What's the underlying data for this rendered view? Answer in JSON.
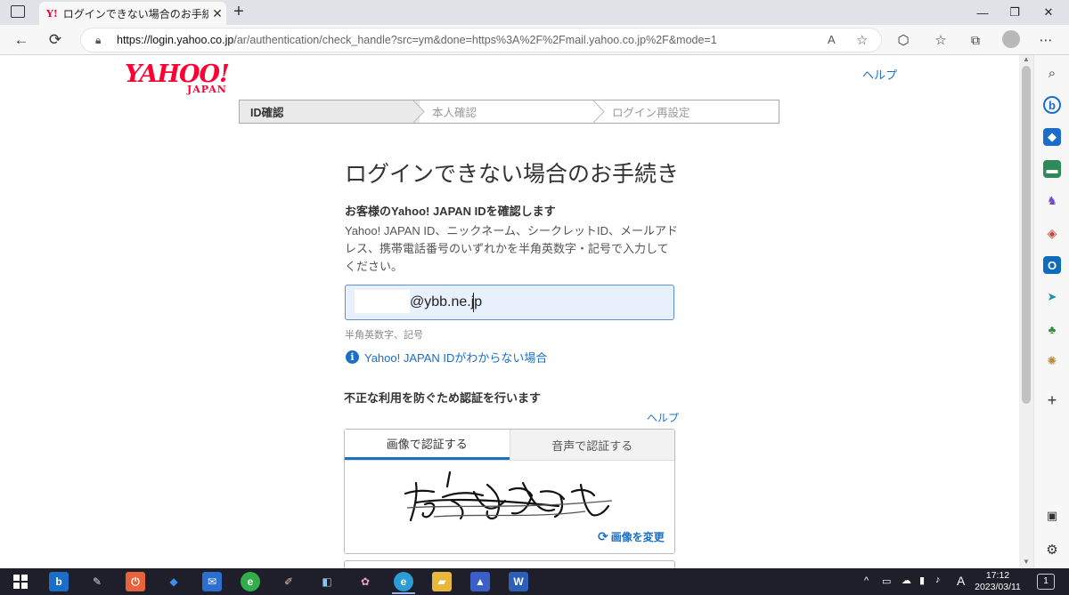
{
  "browser": {
    "tab_title": "ログインできない場合のお手続き - Ya",
    "tab_favicon": "Y!",
    "url_host": "https://login.yahoo.co.jp",
    "url_path": "/ar/authentication/check_handle?src=ym&done=https%3A%2F%2Fmail.yahoo.co.jp%2F&mode=1"
  },
  "header": {
    "logo_main": "YAHOO!",
    "logo_sub": "JAPAN",
    "help": "ヘルプ"
  },
  "steps": [
    "ID確認",
    "本人確認",
    "ログイン再設定"
  ],
  "main": {
    "heading": "ログインできない場合のお手続き",
    "id_section_title": "お客様のYahoo! JAPAN IDを確認します",
    "id_description": "Yahoo! JAPAN ID、ニックネーム、シークレットID、メールアドレス、携帯電話番号のいずれかを半角英数字・記号で入力してください。",
    "id_value": "@ybb.ne.jp",
    "id_hint": "半角英数字、記号",
    "id_help_link": "Yahoo! JAPAN IDがわからない場合",
    "captcha_title": "不正な利用を防ぐため認証を行います",
    "captcha_help": "ヘルプ",
    "captcha_tab_image": "画像で認証する",
    "captcha_tab_audio": "音声で認証する",
    "captcha_refresh": "画像を変更"
  },
  "taskbar": {
    "time": "17:12",
    "date": "2023/03/11",
    "ime": "A"
  },
  "colors": {
    "yahoo_red": "#ff0033",
    "link_blue": "#1a6ec8",
    "taskbar": "#1f1f2b"
  }
}
